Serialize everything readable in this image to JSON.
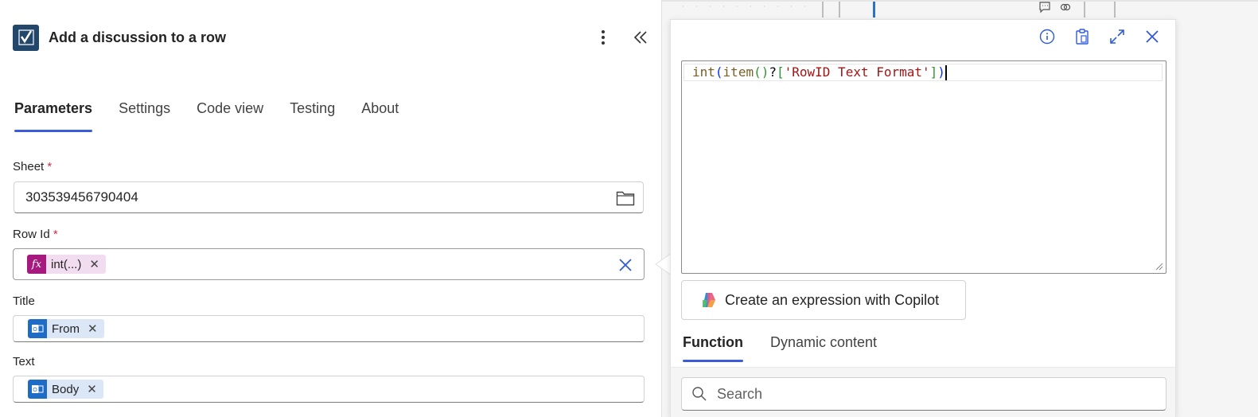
{
  "header": {
    "title": "Add a discussion to a row"
  },
  "tabs": [
    {
      "label": "Parameters",
      "active": true
    },
    {
      "label": "Settings",
      "active": false
    },
    {
      "label": "Code view",
      "active": false
    },
    {
      "label": "Testing",
      "active": false
    },
    {
      "label": "About",
      "active": false
    }
  ],
  "fields": {
    "sheet": {
      "label": "Sheet",
      "required_mark": "*",
      "value": "303539456790404"
    },
    "row_id": {
      "label": "Row Id",
      "required_mark": "*",
      "token": "int(...)"
    },
    "title": {
      "label": "Title",
      "token": "From"
    },
    "text": {
      "label": "Text",
      "token": "Body"
    }
  },
  "expression_editor": {
    "parts": {
      "fn_int": "int",
      "open_paren": "(",
      "fn_item": "item",
      "call": "()",
      "safe_nav": "?",
      "open_bracket": "[",
      "string": "'RowID Text Format'",
      "close_bracket": "]",
      "close_paren": ")"
    },
    "copilot_button": "Create an expression with Copilot",
    "sub_tabs": [
      {
        "label": "Function",
        "active": true
      },
      {
        "label": "Dynamic content",
        "active": false
      }
    ],
    "search_placeholder": "Search"
  },
  "colors": {
    "accent": "#3b5bdb",
    "fx_token": "#a6197f",
    "outlook_token": "#1f6cc7",
    "required": "#c4314b"
  }
}
